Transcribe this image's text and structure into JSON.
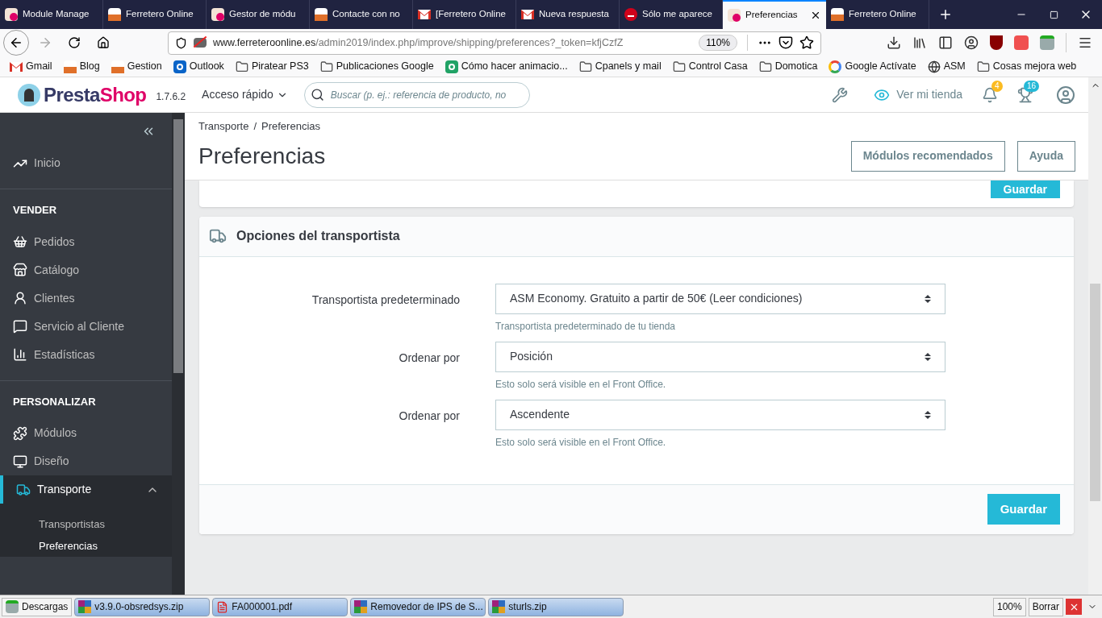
{
  "browser": {
    "tabs": [
      {
        "title": "Module Manage",
        "selected": false,
        "kind": "shop"
      },
      {
        "title": "Ferretero Online",
        "selected": false,
        "kind": "store"
      },
      {
        "title": "Gestor de módu",
        "selected": false,
        "kind": "shop"
      },
      {
        "title": "Contacte con no",
        "selected": false,
        "kind": "store"
      },
      {
        "title": "[Ferretero Online",
        "selected": false,
        "kind": "mail"
      },
      {
        "title": "Nueva respuesta",
        "selected": false,
        "kind": "mail"
      },
      {
        "title": "Sólo me aparece",
        "selected": false,
        "kind": "w"
      },
      {
        "title": "Preferencias",
        "selected": true,
        "kind": "shop"
      },
      {
        "title": "Ferretero Online",
        "selected": false,
        "kind": "store"
      }
    ],
    "url_host": "www.ferreteroonline.es",
    "url_path": "/admin2019/index.php/improve/shipping/preferences?_token=kfjCzfZ",
    "zoom": "110%",
    "bookmarks": [
      {
        "label": "Gmail",
        "kind": "mail"
      },
      {
        "label": "Blog",
        "kind": "store"
      },
      {
        "label": "Gestion",
        "kind": "store"
      },
      {
        "label": "Outlook",
        "kind": "outlook"
      },
      {
        "label": "Piratear PS3",
        "kind": "folder"
      },
      {
        "label": "Publicaciones Google",
        "kind": "folder"
      },
      {
        "label": "Cómo hacer animacio...",
        "kind": "s"
      },
      {
        "label": "Cpanels y mail",
        "kind": "folder"
      },
      {
        "label": "Control Casa",
        "kind": "folder"
      },
      {
        "label": "Domotica",
        "kind": "folder"
      },
      {
        "label": "Google Actívate",
        "kind": "google"
      },
      {
        "label": "ASM",
        "kind": "globe"
      },
      {
        "label": "Cosas mejora web",
        "kind": "folder"
      }
    ]
  },
  "header": {
    "logo_a": "Presta",
    "logo_b": "Shop",
    "version": "1.7.6.2",
    "quick_access": "Acceso rápido",
    "search_placeholder": "Buscar (p. ej.: referencia de producto, no",
    "view_store": "Ver mi tienda",
    "notifications": "4",
    "trophies": "16"
  },
  "sidebar": [
    {
      "kind": "item",
      "label": "Inicio",
      "selected": false
    },
    {
      "kind": "heading",
      "label": "VENDER"
    },
    {
      "kind": "item",
      "label": "Pedidos",
      "selected": false
    },
    {
      "kind": "item",
      "label": "Catálogo",
      "selected": false
    },
    {
      "kind": "item",
      "label": "Clientes",
      "selected": false
    },
    {
      "kind": "item",
      "label": "Servicio al Cliente",
      "selected": false
    },
    {
      "kind": "item",
      "label": "Estadísticas",
      "selected": false
    },
    {
      "kind": "heading",
      "label": "PERSONALIZAR"
    },
    {
      "kind": "item",
      "label": "Módulos",
      "selected": false
    },
    {
      "kind": "item",
      "label": "Diseño",
      "selected": false
    },
    {
      "kind": "item",
      "label": "Transporte",
      "selected": true,
      "expanded": true,
      "children": [
        {
          "label": "Transportistas",
          "selected": false
        },
        {
          "label": "Preferencias",
          "selected": true
        }
      ]
    }
  ],
  "page": {
    "breadcrumb": [
      "Transporte",
      "Preferencias"
    ],
    "breadcrumb_separator": "/",
    "title": "Preferencias",
    "buttons": [
      "Módulos recomendados",
      "Ayuda"
    ],
    "top_card_button": "Guardar",
    "card": {
      "title": "Opciones del transportista",
      "fields": [
        {
          "label": "Transportista predeterminado",
          "value": "ASM Economy. Gratuito a partir de 50€ (Leer condiciones)",
          "help": "Transportista predeterminado de tu tienda"
        },
        {
          "label": "Ordenar por",
          "value": "Posición",
          "help": "Esto solo será visible en el Front Office."
        },
        {
          "label": "Ordenar por",
          "value": "Ascendente",
          "help": "Esto solo será visible en el Front Office."
        }
      ],
      "save": "Guardar"
    }
  },
  "downloads": {
    "label": "Descargas",
    "items": [
      {
        "name": "v3.9.0-obsredsys.zip",
        "kind": "zip"
      },
      {
        "name": "FA000001.pdf",
        "kind": "pdf"
      },
      {
        "name": "Removedor de IPS de S...",
        "kind": "zip"
      },
      {
        "name": "sturls.zip",
        "kind": "zip"
      }
    ],
    "zoom": "100%",
    "clear": "Borrar"
  }
}
